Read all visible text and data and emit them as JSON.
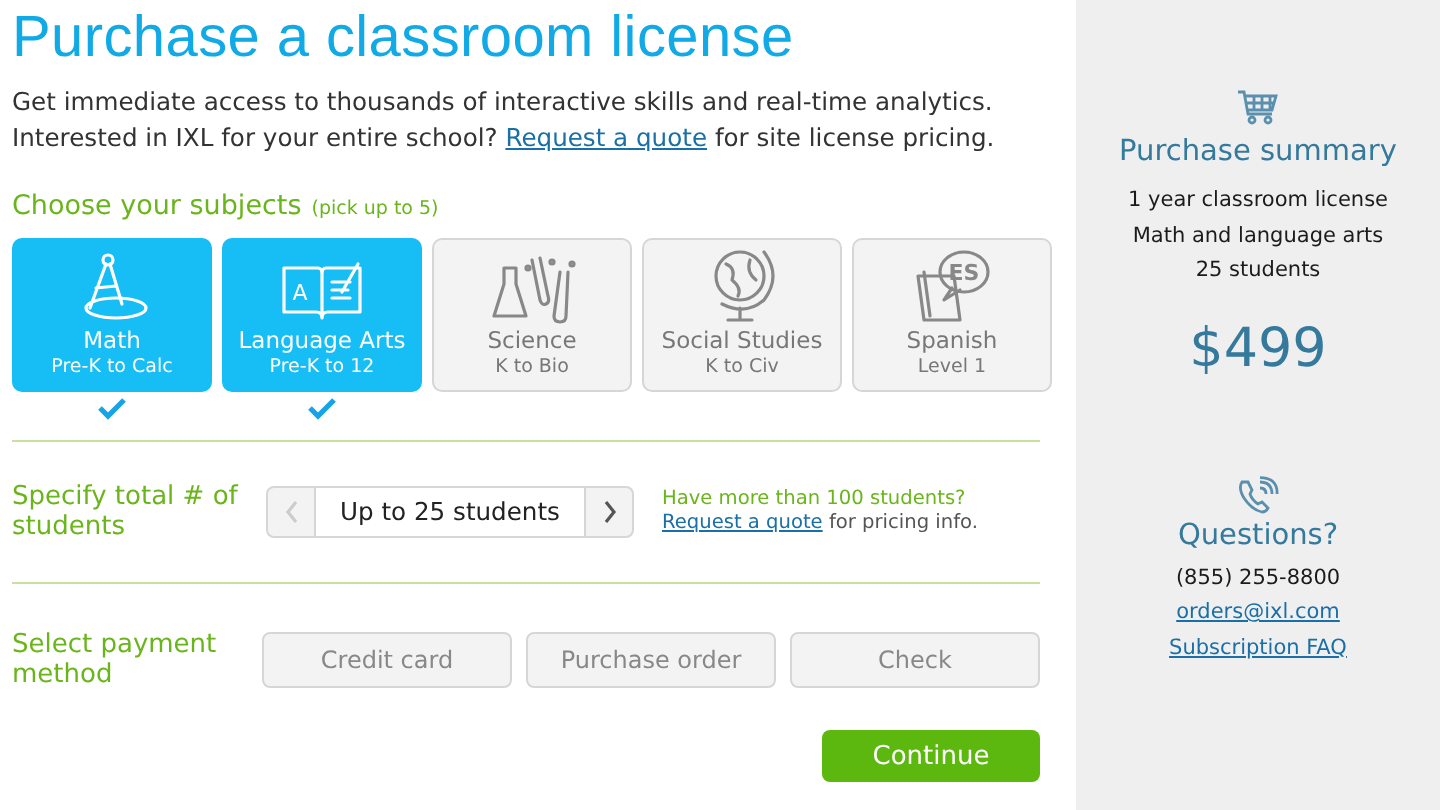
{
  "title": "Purchase a classroom license",
  "intro": {
    "text": "Get immediate access to thousands of interactive skills and real-time analytics. Interested in IXL for your entire school?",
    "link": "Request a quote",
    "after": "for site license pricing."
  },
  "subjects_section": {
    "heading": "Choose your subjects",
    "hint": "(pick up to 5)"
  },
  "subjects": [
    {
      "name": "Math",
      "range": "Pre-K to Calc",
      "selected": true
    },
    {
      "name": "Language Arts",
      "range": "Pre-K to 12",
      "selected": true,
      "icon_text": "A"
    },
    {
      "name": "Science",
      "range": "K to Bio",
      "selected": false
    },
    {
      "name": "Social Studies",
      "range": "K to Civ",
      "selected": false
    },
    {
      "name": "Spanish",
      "range": "Level 1",
      "selected": false,
      "icon_text": "ES"
    }
  ],
  "students": {
    "label": "Specify total # of students",
    "value": "Up to 25 students",
    "prev_disabled": true,
    "next_disabled": false,
    "note": "Have more than 100 students?",
    "link": "Request a quote",
    "after": "for pricing info."
  },
  "payment": {
    "label": "Select payment method",
    "options": [
      {
        "label": "Credit card",
        "selected": false
      },
      {
        "label": "Purchase order",
        "selected": false
      },
      {
        "label": "Check",
        "selected": false
      }
    ]
  },
  "continue": "Continue",
  "summary": {
    "title": "Purchase summary",
    "lines": [
      "1 year classroom license",
      "Math and language arts",
      "25 students"
    ],
    "price": "$499"
  },
  "questions": {
    "title": "Questions?",
    "phone": "(855) 255-8800",
    "email": "orders@ixl.com",
    "faq": "Subscription FAQ"
  }
}
